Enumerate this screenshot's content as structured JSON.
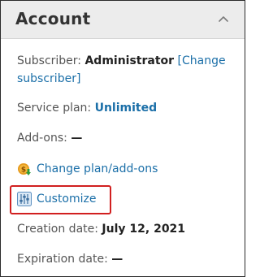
{
  "panel": {
    "title": "Account",
    "collapse_icon": "chevron-up-icon"
  },
  "subscriber": {
    "label": "Subscriber:",
    "value": "Administrator",
    "change_link_line1": "[Change",
    "change_link_line2": "subscriber]"
  },
  "service_plan": {
    "label": "Service plan:",
    "value": "Unlimited"
  },
  "addons": {
    "label": "Add-ons:",
    "value": "—"
  },
  "change_plan": {
    "icon": "plan-change-icon",
    "label": "Change plan/add-ons"
  },
  "customize": {
    "icon": "sliders-icon",
    "label": "Customize",
    "highlight_color": "#d11f1f"
  },
  "creation_date": {
    "label": "Creation date:",
    "value": "July 12, 2021"
  },
  "expiration_date": {
    "label": "Expiration date:",
    "value": "—"
  },
  "colors": {
    "link": "#1b6fa8",
    "header_bg": "#ececec"
  }
}
